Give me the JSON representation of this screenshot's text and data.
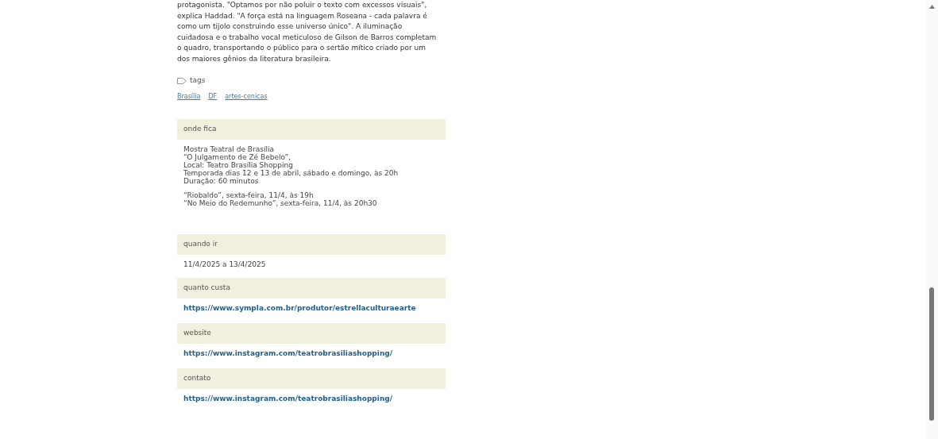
{
  "article": {
    "text": "protagonista. \"Optamos por não poluir o texto com excessos visuais\", explica Haddad. \"A força está na linguagem Roseana - cada palavra é como um tijolo construindo esse universo único\". A iluminação cuidadosa e o trabalho vocal meticuloso de Gilson de Barros completam o quadro, transportando o público para o sertão mítico criado por um dos maiores gênios da literatura brasileira."
  },
  "tags": {
    "label": "tags",
    "items": [
      "Brasília",
      "DF",
      "artes-cenicas"
    ]
  },
  "sections": [
    {
      "kind": "text",
      "title": "onde fica",
      "paragraphs": [
        [
          "Mostra Teatral de Brasília",
          "“O Julgamento de Zé Bebelo”,",
          "Local: Teatro Brasília Shopping",
          "Temporada dias 12 e 13 de abril, sábado e domingo, às 20h",
          "Duração: 60 minutos"
        ],
        [
          "“Riobaldo”, sexta-feira, 11/4, às 19h",
          "“No Meio do Redemunho”, sexta-feira, 11/4, às 20h30"
        ]
      ]
    },
    {
      "kind": "text",
      "title": "quando ir",
      "paragraphs": [
        [
          "11/4/2025 a 13/4/2025"
        ]
      ]
    },
    {
      "kind": "link",
      "title": "quanto custa",
      "value": "https://www.sympla.com.br/produtor/estrellaculturaearte"
    },
    {
      "kind": "link",
      "title": "website",
      "value": "https://www.instagram.com/teatrobrasiliashopping/"
    },
    {
      "kind": "link",
      "title": "contato",
      "value": "https://www.instagram.com/teatrobrasiliashopping/"
    }
  ]
}
